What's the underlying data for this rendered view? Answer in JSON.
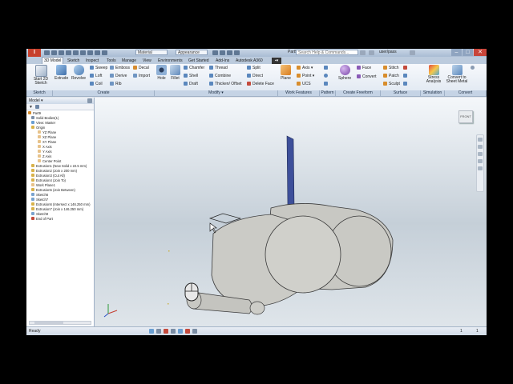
{
  "window": {
    "doc_title": "Part9",
    "search_placeholder": "Search Help & Commands...",
    "user": "user/pass",
    "material": "Material",
    "appearance": "Appearance",
    "minimize": "–",
    "maximize": "□",
    "close": "✕"
  },
  "tabs": [
    {
      "label": "3D Model",
      "active": true
    },
    {
      "label": "Sketch"
    },
    {
      "label": "Inspect"
    },
    {
      "label": "Tools"
    },
    {
      "label": "Manage"
    },
    {
      "label": "View"
    },
    {
      "label": "Environments"
    },
    {
      "label": "Get Started"
    },
    {
      "label": "Add-Ins"
    },
    {
      "label": "Autodesk A360"
    }
  ],
  "ribbon": {
    "panels": [
      "Sketch",
      "Create",
      "Modify ▾",
      "Work Features",
      "Pattern",
      "Create Freeform",
      "Surface",
      "Simulation",
      "Convert"
    ],
    "start_sketch": "Start 2D Sketch",
    "extrude": "Extrude",
    "revolve": "Revolve",
    "sweep": "Sweep",
    "loft": "Loft",
    "coil": "Coil",
    "emboss": "Emboss",
    "derive": "Derive",
    "rib": "Rib",
    "decal": "Decal",
    "import": "Import",
    "hole": "Hole",
    "fillet": "Fillet",
    "chamfer": "Chamfer",
    "shell": "Shell",
    "draft": "Draft",
    "thread": "Thread",
    "combine": "Combine",
    "thicken": "Thicken/ Offset",
    "split": "Split",
    "direct": "Direct",
    "delete_face": "Delete Face",
    "plane": "Plane",
    "axis": "Axis ▾",
    "point": "Point ▾",
    "ucs": "UCS",
    "sphere": "Sphere",
    "face": "Face",
    "convert": "Convert",
    "stitch": "Stitch",
    "patch": "Patch",
    "sculpt": "Sculpt",
    "stress": "Stress Analysis",
    "convert_sheet": "Convert to Sheet Metal"
  },
  "browser": {
    "title": "Model ▾",
    "items": [
      "Part9",
      "Solid Bodies(1)",
      "View: Master",
      "Origin",
      "YZ Plane",
      "XZ Plane",
      "XY Plane",
      "X Axis",
      "Y Axis",
      "Z Axis",
      "Center Point",
      "Extrusion1 (New Solid x 22.5 mm)",
      "Extrusion2 (Join x 200 mm)",
      "Extrusion3 (Cut All)",
      "Extrusion4 (Join To)",
      "Work Plane1",
      "Extrusion5 (Join Between)",
      "Sketch6",
      "Sketch7",
      "Extrusion6 (Intersect x 146.250 mm)",
      "Extrusion7 (Join x 146.250 mm)",
      "Sketch9",
      "End of Part"
    ]
  },
  "viewcube_label": "FRONT",
  "status": {
    "text": "Ready",
    "count1": "1",
    "count2": "1"
  },
  "colors": {
    "body": "#c8c8c3",
    "body_edge": "#3a3a3a",
    "work_plane": "#3d4f9a",
    "app_button": "#c7402c"
  }
}
